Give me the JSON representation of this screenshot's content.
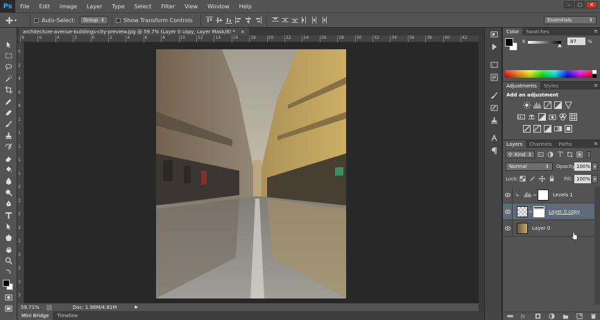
{
  "app": {
    "logo": "Ps"
  },
  "menu": [
    "File",
    "Edit",
    "Image",
    "Layer",
    "Type",
    "Select",
    "Filter",
    "View",
    "Window",
    "Help"
  ],
  "window_controls": [
    "–",
    "□",
    "✕"
  ],
  "options": {
    "auto_select_label": "Auto-Select:",
    "auto_select_value": "Group",
    "transform_label": "Show Transform Controls",
    "workspace": "Essentials"
  },
  "document": {
    "tab_title": "architecture-avenue-buildings-city-preview.jpg @ 59.7% (Layer 0 copy, Layer Mask/8) *",
    "tab_close": "×",
    "zoom": "59.71%",
    "doc_info": "Doc: 1.96M/4.81M",
    "ruler_top": [
      "8",
      "6",
      "4",
      "2",
      "0",
      "2",
      "4",
      "6",
      "8",
      "10",
      "12",
      "14",
      "16",
      "18",
      "20",
      "22",
      "24",
      "26",
      "28",
      "30",
      "32",
      "34",
      "36",
      "38",
      "40",
      "42"
    ],
    "ruler_left": [
      "0",
      "2",
      "4",
      "6",
      "8",
      "1",
      "1",
      "1",
      "1",
      "1",
      "2",
      "2",
      "2",
      "2",
      "2",
      "3",
      "3",
      "3",
      "3"
    ]
  },
  "bottom_tabs": [
    "Mini Bridge",
    "Timeline"
  ],
  "color_panel": {
    "tabs": [
      "Color",
      "Swatches"
    ],
    "channel": "K",
    "value": "87",
    "unit": "%"
  },
  "adjustments": {
    "tabs": [
      "Adjustments",
      "Styles"
    ],
    "title": "Add an adjustment"
  },
  "layers_panel": {
    "tabs": [
      "Layers",
      "Channels",
      "Paths"
    ],
    "kind": "Kind",
    "blend_mode": "Normal",
    "opacity_label": "Opacity:",
    "opacity": "100%",
    "lock_label": "Lock:",
    "fill_label": "Fill:",
    "fill": "100%",
    "layers": [
      {
        "name": "Levels 1",
        "selected": false
      },
      {
        "name": "Layer 0 copy",
        "selected": true
      },
      {
        "name": "Layer 0",
        "selected": false
      }
    ]
  }
}
